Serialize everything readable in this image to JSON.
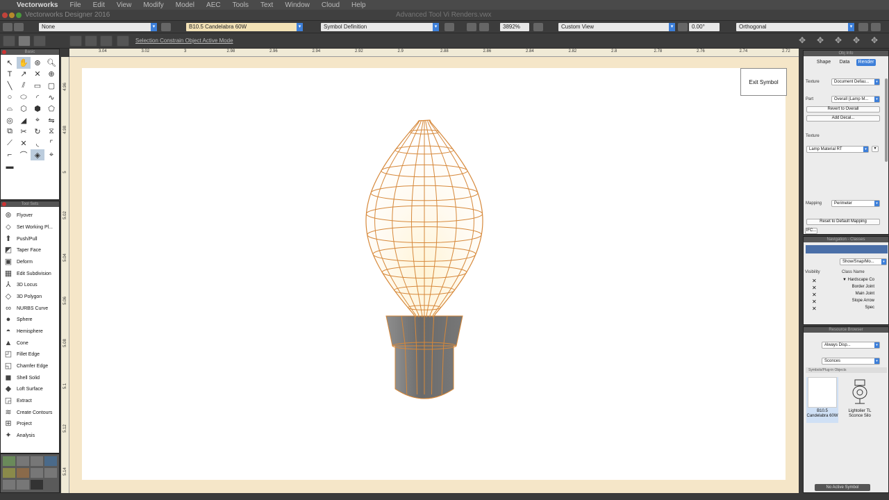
{
  "menubar": {
    "app": "Vectorworks",
    "items": [
      "File",
      "Edit",
      "View",
      "Modify",
      "Model",
      "AEC",
      "Tools",
      "Text",
      "Window",
      "Cloud",
      "Help"
    ]
  },
  "window": {
    "app_title": "Vectorworks Designer 2016",
    "doc_title": "Advanced Tool Vi Renders.vwx"
  },
  "viewbar": {
    "class": "None",
    "symbol": "B10.5 Candelabra 60W",
    "layer": "Symbol Definition",
    "zoom": "3892%",
    "view": "Custom View",
    "angle": "0.00°",
    "projection": "Orthogonal"
  },
  "modebar": {
    "hint": "Selection Constrain Object Active Mode"
  },
  "basic_palette": {
    "title": "Basic"
  },
  "toolset_palette": {
    "title": "Tool Sets",
    "tools": [
      {
        "icon": "flyover-icon",
        "label": "Flyover"
      },
      {
        "icon": "set-working-plane-icon",
        "label": "Set Working Pl..."
      },
      {
        "icon": "push-pull-icon",
        "label": "Push/Pull"
      },
      {
        "icon": "taper-face-icon",
        "label": "Taper Face"
      },
      {
        "icon": "deform-icon",
        "label": "Deform"
      },
      {
        "icon": "edit-subdivision-icon",
        "label": "Edit Subdivision"
      },
      {
        "icon": "3d-locus-icon",
        "label": "3D Locus"
      },
      {
        "icon": "3d-polygon-icon",
        "label": "3D Polygon"
      },
      {
        "icon": "nurbs-curve-icon",
        "label": "NURBS Curve"
      },
      {
        "icon": "sphere-icon",
        "label": "Sphere"
      },
      {
        "icon": "hemisphere-icon",
        "label": "Hemisphere"
      },
      {
        "icon": "cone-icon",
        "label": "Cone"
      },
      {
        "icon": "fillet-edge-icon",
        "label": "Fillet Edge"
      },
      {
        "icon": "chamfer-edge-icon",
        "label": "Chamfer Edge"
      },
      {
        "icon": "shell-solid-icon",
        "label": "Shell Solid"
      },
      {
        "icon": "loft-surface-icon",
        "label": "Loft Surface"
      },
      {
        "icon": "extract-icon",
        "label": "Extract"
      },
      {
        "icon": "create-contours-icon",
        "label": "Create Contours"
      },
      {
        "icon": "project-icon",
        "label": "Project"
      },
      {
        "icon": "analysis-icon",
        "label": "Analysis"
      }
    ]
  },
  "ruler_top": [
    "3.04",
    "3.02",
    "3",
    "2.98",
    "2.96",
    "2.94",
    "2.92",
    "2.9",
    "2.88",
    "2.86",
    "2.84",
    "2.82",
    "2.8",
    "2.78",
    "2.76",
    "2.74",
    "2.72"
  ],
  "ruler_left": [
    "4.96",
    "4.98",
    "5",
    "5.02",
    "5.04",
    "5.06",
    "5.08",
    "5.1",
    "5.12",
    "5.14"
  ],
  "canvas": {
    "exit_button": "Exit Symbol"
  },
  "obj_info": {
    "title": "Obj Info",
    "tabs": [
      "Shape",
      "Data",
      "Render"
    ],
    "active_tab": "Render",
    "texture_label": "Texture",
    "texture_value": "Document Defau...",
    "part_label": "Part",
    "part_value": "Overall (Lamp M...",
    "revert_btn": "Revert to Overall",
    "decal_btn": "Add Decal...",
    "texture2_label": "Texture",
    "texture2_value": "Lamp Material RT",
    "mapping_label": "Mapping",
    "mapping_value": "Perimeter",
    "reset_btn": "Reset to Default Mapping",
    "ifc_btn": "IFC..."
  },
  "navigation": {
    "title": "Navigation - Classes",
    "show_label": "Show/Snap/Mo...",
    "col_visibility": "Visibility",
    "col_name": "Class Name",
    "rows": [
      "▼ Hardscape Co",
      "Border Joint",
      "Main Joint",
      "Slope Arrow",
      "Spec"
    ]
  },
  "resource_browser": {
    "title": "Resource Browser",
    "file_value": "Always Disp...",
    "folder_value": "Sconces",
    "section": "Symbols/Plug-in Objects",
    "items": [
      "B10.5 Candelabra 60W",
      "Lightolier TL Sconce Silo"
    ],
    "status": "No Active Symbol"
  },
  "colors": {
    "wire": "#d6883a",
    "glow": "#fff1c9",
    "base": "#7a7a7a",
    "canvas_border": "#f5e6c8",
    "accent": "#3d7fd9"
  }
}
